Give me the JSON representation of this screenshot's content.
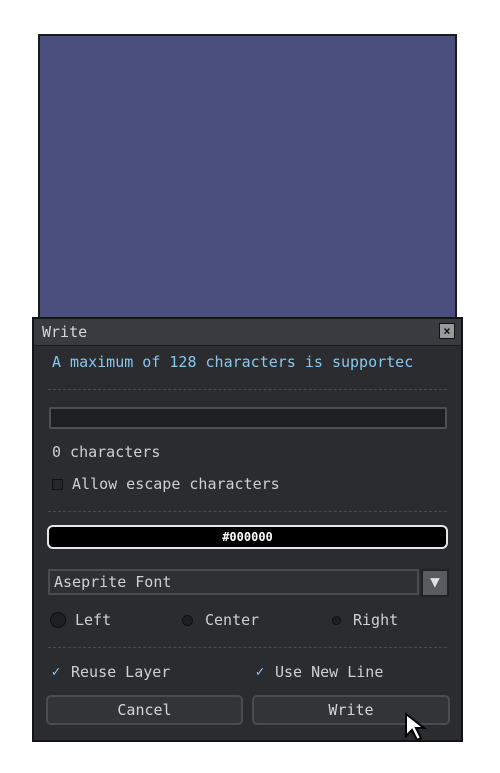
{
  "dialog": {
    "title": "Write",
    "close_icon": "close-icon",
    "info": "A maximum of 128 characters is supportec",
    "text_value": "",
    "char_count": "0 characters",
    "escape_label": "Allow escape characters",
    "escape_checked": false,
    "color_label": "#000000",
    "color_value": "#000000",
    "font_value": "Aseprite Font",
    "align": {
      "left": "Left",
      "center": "Center",
      "right": "Right",
      "selected": "Left"
    },
    "reuse_label": "Reuse Layer",
    "reuse_checked": true,
    "newline_label": "Use New Line",
    "newline_checked": true,
    "cancel_label": "Cancel",
    "write_label": "Write"
  },
  "colors": {
    "canvas": "#4b4f7e",
    "panel": "#2b2c30",
    "info_text": "#86c8ef"
  }
}
